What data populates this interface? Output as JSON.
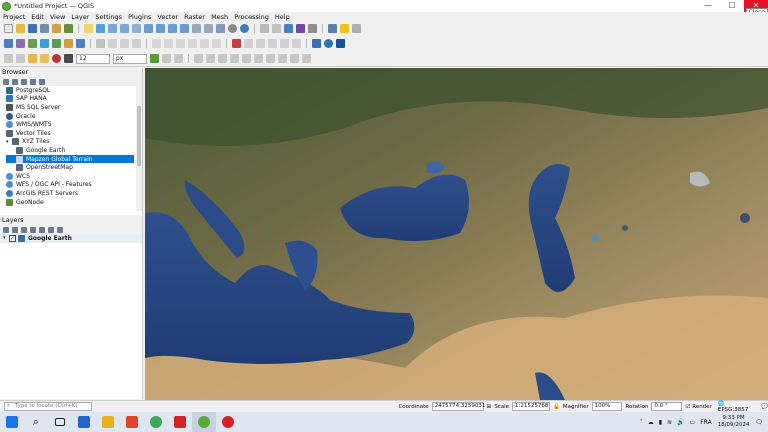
{
  "window": {
    "title": "*Untitled Project — QGIS",
    "close_tooltip": "Close"
  },
  "menu": [
    "Project",
    "Edit",
    "View",
    "Layer",
    "Settings",
    "Plugins",
    "Vector",
    "Raster",
    "Mesh",
    "Processing",
    "Help"
  ],
  "toolbar": {
    "font_size_value": "12",
    "unit_value": "px"
  },
  "browser": {
    "title": "Browser",
    "items": [
      {
        "label": "PostgreSQL",
        "icon": "postgresql-icon",
        "color": "#33678f"
      },
      {
        "label": "SAP HANA",
        "icon": "sap-hana-icon",
        "color": "#2b78c2"
      },
      {
        "label": "MS SQL Server",
        "icon": "mssql-icon",
        "color": "#555555"
      },
      {
        "label": "Oracle",
        "icon": "oracle-icon",
        "color": "#2d5a8a"
      },
      {
        "label": "WMS/WMTS",
        "icon": "wms-icon",
        "color": "#4a8ccf"
      },
      {
        "label": "Vector Tiles",
        "icon": "vector-tiles-icon",
        "color": "#556677"
      },
      {
        "label": "XYZ Tiles",
        "icon": "xyz-tiles-icon",
        "color": "#556677"
      },
      {
        "label": "Google Earth",
        "icon": "tile-layer-icon",
        "color": "#556677"
      },
      {
        "label": "Mapzen Global Terrain",
        "icon": "tile-layer-icon",
        "color": "#556677"
      },
      {
        "label": "OpenStreetMap",
        "icon": "tile-layer-icon",
        "color": "#556677"
      },
      {
        "label": "WCS",
        "icon": "wcs-icon",
        "color": "#4a8ccf"
      },
      {
        "label": "WFS / OGC API - Features",
        "icon": "wfs-icon",
        "color": "#4a8ccf"
      },
      {
        "label": "ArcGIS REST Servers",
        "icon": "arcgis-icon",
        "color": "#3a7ab8"
      },
      {
        "label": "GeoNode",
        "icon": "geonode-icon",
        "color": "#5c8a3a"
      }
    ]
  },
  "layers": {
    "title": "Layers",
    "items": [
      {
        "label": "Google Earth",
        "checked": true
      }
    ]
  },
  "status": {
    "locator_placeholder": "Type to locate (Ctrl+K)",
    "coordinate_label": "Coordinate",
    "coordinate_value": "2475774,3259031",
    "scale_label": "Scale",
    "scale_value": "1:21525768",
    "magnifier_label": "Magnifier",
    "magnifier_value": "100%",
    "rotation_label": "Rotation",
    "rotation_value": "0.0 °",
    "render_label": "Render",
    "crs_label": "EPSG:3857"
  },
  "taskbar": {
    "apps": [
      {
        "name": "windows-start-icon",
        "color": "#1a73e8"
      },
      {
        "name": "search-icon",
        "color": "#222222"
      },
      {
        "name": "task-view-icon",
        "color": "#222222"
      },
      {
        "name": "mail-icon",
        "color": "#2266cc"
      },
      {
        "name": "file-explorer-icon",
        "color": "#e8b020"
      },
      {
        "name": "office-icon",
        "color": "#e0452b"
      },
      {
        "name": "chrome-icon",
        "color": "#3aa757"
      },
      {
        "name": "acrobat-icon",
        "color": "#d32222"
      },
      {
        "name": "qgis-icon",
        "color": "#5bab3b"
      },
      {
        "name": "opera-icon",
        "color": "#d81f26"
      }
    ],
    "language": "FRA",
    "time": "9:33 PM",
    "date": "18/09/2024"
  }
}
